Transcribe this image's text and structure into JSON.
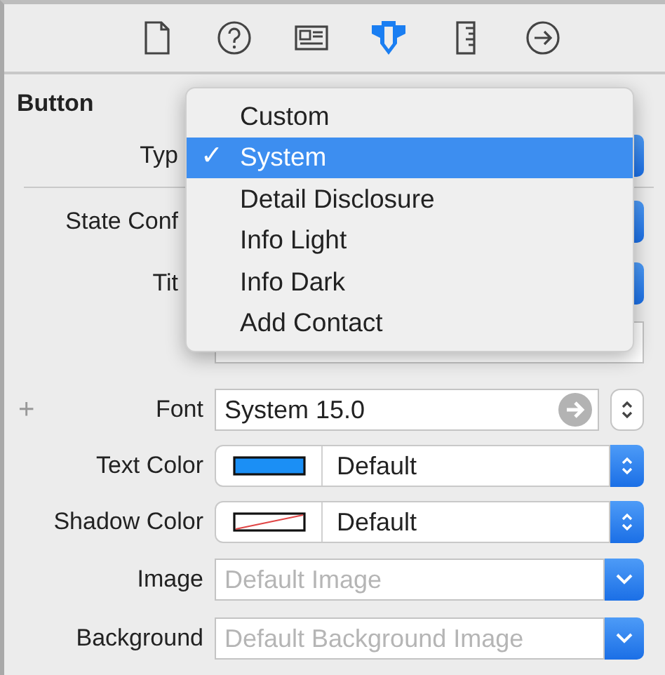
{
  "toolbar": {
    "tabs": [
      {
        "kind": "file",
        "selected": false
      },
      {
        "kind": "help",
        "selected": false
      },
      {
        "kind": "identity",
        "selected": false
      },
      {
        "kind": "attributes",
        "selected": true
      },
      {
        "kind": "size",
        "selected": false
      },
      {
        "kind": "connections",
        "selected": false
      }
    ]
  },
  "section": {
    "title": "Button"
  },
  "rows": [
    {
      "kind": "popup",
      "label": "Typ",
      "divider_after": true
    },
    {
      "kind": "popup",
      "label": "State Conf"
    },
    {
      "kind": "popup",
      "label": "Tit"
    },
    {
      "kind": "field"
    },
    {
      "kind": "font",
      "add": "+",
      "label": "Font",
      "value": "System 15.0"
    },
    {
      "kind": "color",
      "label": "Text Color",
      "color": "#1b8ff5",
      "value": "Default"
    },
    {
      "kind": "color",
      "label": "Shadow Color",
      "clear": true,
      "value": "Default"
    },
    {
      "kind": "image",
      "label": "Image",
      "placeholder": "Default Image"
    },
    {
      "kind": "image",
      "label": "Background",
      "placeholder": "Default Background Image"
    }
  ],
  "menu": {
    "checkmark": "✓",
    "items": [
      {
        "label": "Custom",
        "selected": false
      },
      {
        "label": "System",
        "selected": true
      },
      {
        "label": "Detail Disclosure",
        "selected": false
      },
      {
        "label": "Info Light",
        "selected": false
      },
      {
        "label": "Info Dark",
        "selected": false
      },
      {
        "label": "Add Contact",
        "selected": false
      }
    ]
  }
}
